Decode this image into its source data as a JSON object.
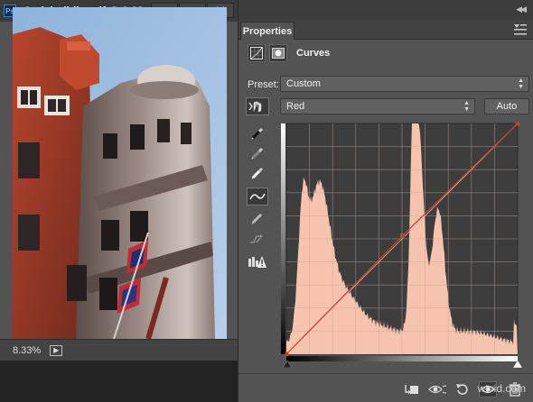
{
  "document_window": {
    "ps_logo": "Ps",
    "title": "© uk building.tif @ 8.33...",
    "zoom_level": "8.33%"
  },
  "properties_panel": {
    "tab_label": "Properties",
    "adjustment_title": "Curves",
    "preset_label": "Preset:",
    "preset_value": "Custom",
    "channel_value": "Red",
    "auto_button_label": "Auto"
  },
  "curve": {
    "channel_color": "#c8402f",
    "histogram_color": "#f6c4ae",
    "graph_background": "#3d3d3d",
    "control_points": [
      [
        0,
        0
      ],
      [
        128,
        131
      ],
      [
        255,
        255
      ]
    ]
  },
  "watermark": "wtvid.com"
}
